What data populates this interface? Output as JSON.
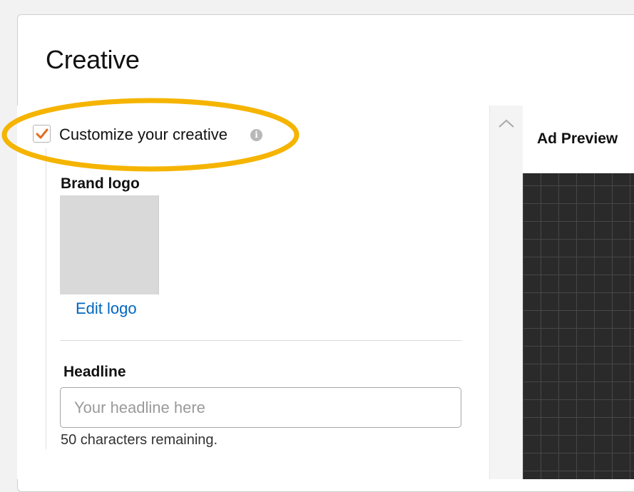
{
  "card": {
    "title": "Creative"
  },
  "customize": {
    "label": "Customize your creative",
    "checked": true,
    "info_icon": "info-icon",
    "highlight_color": "#f5b400",
    "check_color": "#e46c1f"
  },
  "brand_logo": {
    "label": "Brand logo",
    "edit_link": "Edit logo"
  },
  "headline": {
    "label": "Headline",
    "placeholder": "Your headline here",
    "value": "",
    "remaining_text": "50 characters remaining."
  },
  "preview": {
    "title": "Ad Preview"
  },
  "scrollbar": {
    "icon": "chevron-up-icon"
  },
  "colors": {
    "link": "#0066c0",
    "preview_background": "#2a2a2a"
  }
}
